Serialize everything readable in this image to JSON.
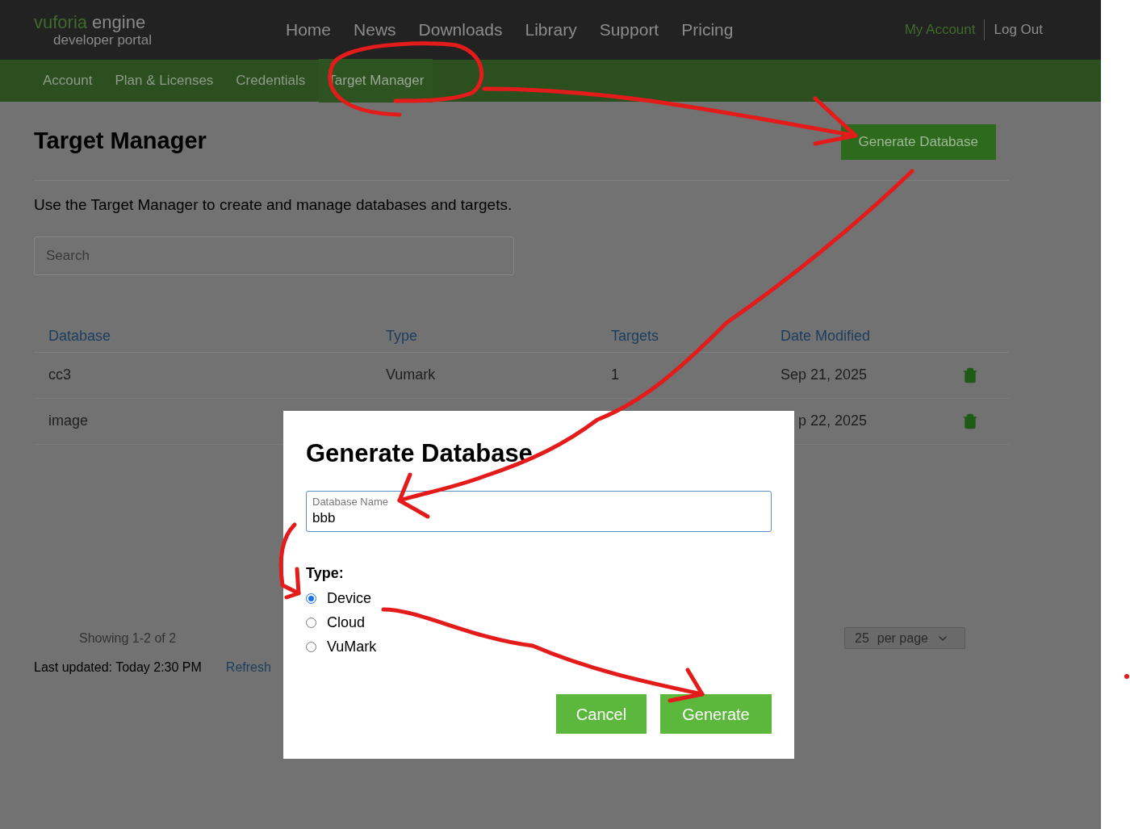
{
  "header": {
    "logo": {
      "brand": "vuforia",
      "product": "engine",
      "tagline": "developer portal"
    },
    "nav": [
      "Home",
      "News",
      "Downloads",
      "Library",
      "Support",
      "Pricing"
    ],
    "account_links": [
      "My Account",
      "Log Out"
    ]
  },
  "subnav": [
    {
      "label": "Account",
      "selected": false
    },
    {
      "label": "Plan & Licenses",
      "selected": false
    },
    {
      "label": "Credentials",
      "selected": false
    },
    {
      "label": "Target Manager",
      "selected": true
    }
  ],
  "page": {
    "title": "Target Manager",
    "action_button": "Generate Database",
    "description": "Use the Target Manager to create and manage databases and targets.",
    "search": {
      "placeholder": "Search"
    }
  },
  "table": {
    "columns": [
      "Database",
      "Type",
      "Targets",
      "Date Modified"
    ],
    "rows": [
      {
        "database": "cc3",
        "type": "Vumark",
        "targets": "1",
        "date": "Sep 21, 2025"
      },
      {
        "database": "image",
        "date": "p 22, 2025"
      }
    ]
  },
  "footer": {
    "showing": "Showing 1-2 of 2",
    "per_page_value": "25",
    "per_page_label": "per page",
    "last_updated": "Last updated: Today 2:30 PM",
    "refresh": "Refresh"
  },
  "dialog": {
    "title": "Generate Database",
    "field": {
      "label": "Database Name",
      "value": "bbb"
    },
    "type_label": "Type:",
    "options": [
      {
        "label": "Device",
        "selected": true
      },
      {
        "label": "Cloud",
        "selected": false
      },
      {
        "label": "VuMark",
        "selected": false
      }
    ],
    "buttons": [
      "Cancel",
      "Generate"
    ]
  }
}
